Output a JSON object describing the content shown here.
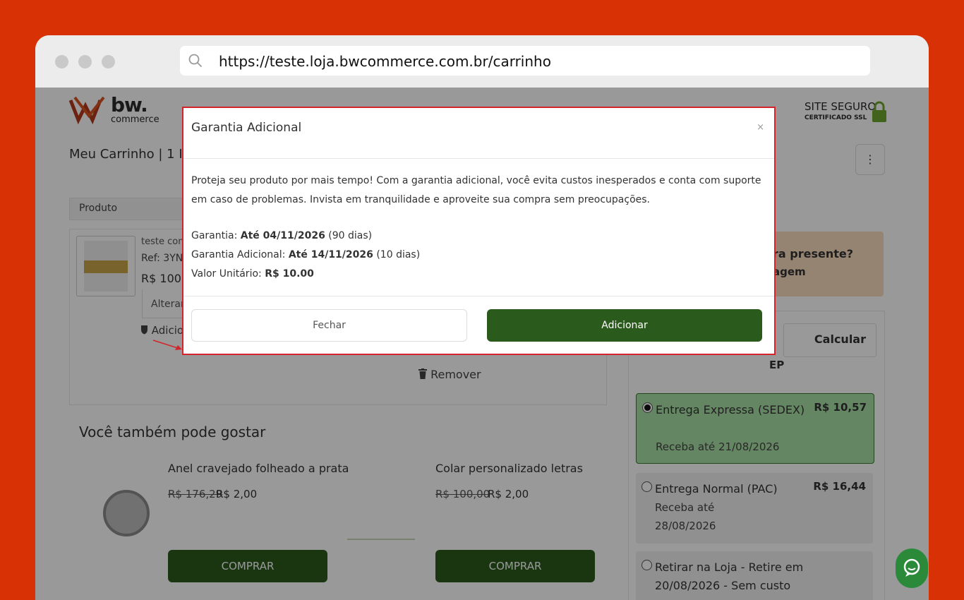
{
  "browser": {
    "url": "https://teste.loja.bwcommerce.com.br/carrinho"
  },
  "header": {
    "logo_main": "bw.",
    "logo_sub": "commerce",
    "secure_line1": "SITE SEGURO",
    "secure_line2": "CERTIFICADO SSL"
  },
  "cart": {
    "title": "Meu Carrinho | 1 Item",
    "menu_icon": "⋮",
    "col_product": "Produto",
    "item_name": "teste com",
    "item_ref": "Ref: 3YN",
    "item_price": "R$ 100.0",
    "alter_label": "Alterar",
    "add_label": "Adicio",
    "remove_label": "Remover"
  },
  "recommend": {
    "title": "Você também pode gostar",
    "products": [
      {
        "name": "Anel cravejado folheado a prata",
        "old_price": "R$ 176,29",
        "new_price": "R$ 2,00",
        "buy_label": "COMPRAR"
      },
      {
        "name": "Colar personalizado letras",
        "old_price": "R$ 100,00",
        "new_price": "R$ 2,00",
        "buy_label": "COMPRAR"
      }
    ]
  },
  "sidebar": {
    "gift_question": "ra presente?",
    "gift_message": "agem",
    "calc_label": "Calcular",
    "cep_label": "EP",
    "shipping": [
      {
        "name": "Entrega Expressa (SEDEX)",
        "price": "R$ 10,57",
        "date": "Receba até 21/08/2026",
        "selected": true
      },
      {
        "name": "Entrega Normal (PAC)",
        "price": "R$ 16,44",
        "date": "Receba até 28/08/2026",
        "selected": false
      },
      {
        "name": "Retirar na Loja - Retire em 20/08/2026 - Sem custo",
        "price": "",
        "date": "",
        "selected": false
      }
    ]
  },
  "modal": {
    "title": "Garantia Adicional",
    "close_icon": "×",
    "description": "Proteja seu produto por mais tempo! Com a garantia adicional, você evita custos inesperados e conta com suporte em caso de problemas. Invista em tranquilidade e aproveite sua compra sem preocupações.",
    "garantia_label": "Garantia:",
    "garantia_value": "Até 04/11/2026",
    "garantia_days": "(90 dias)",
    "adicional_label": "Garantia Adicional:",
    "adicional_value": "Até 14/11/2026",
    "adicional_days": "(10 dias)",
    "unit_label": "Valor Unitário:",
    "unit_value": "R$ 10.00",
    "close_button": "Fechar",
    "add_button": "Adicionar"
  },
  "colors": {
    "background": "#d93106",
    "primary_green": "#2b5a1d",
    "modal_border": "#d4232a",
    "selected_shipping": "#a9dfa6"
  }
}
